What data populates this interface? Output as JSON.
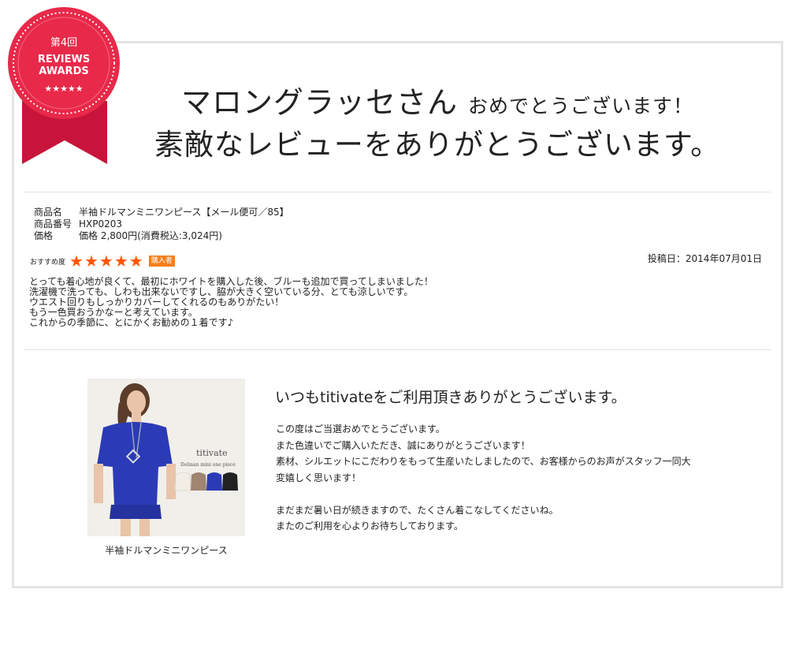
{
  "badge": {
    "edition": "第4回",
    "line1": "REVIEWS",
    "line2": "AWARDS",
    "stars": "★★★★★"
  },
  "headline": {
    "name": "マロングラッセさん",
    "congrats": "おめでとうございます！",
    "thanks": "素敵なレビューをありがとうございます。"
  },
  "product": {
    "name_label": "商品名",
    "name_value": "半袖ドルマンミニワンピース【メール便可／85】",
    "code_label": "商品番号",
    "code_value": "HXP0203",
    "price_label": "価格",
    "price_value": "価格 2,800円(消費税込:3,024円)"
  },
  "rating": {
    "label": "おすすめ度",
    "score": 5,
    "max": 5,
    "buyer_badge": "購入者"
  },
  "posted_date": "投稿日：2014年07月01日",
  "review_text": "とっても着心地が良くて、最初にホワイトを購入した後、ブルーも追加で買ってしまいました！\n洗濯機で洗っても、しわも出来ないですし、脇が大きく空いている分、とても涼しいです。\nウエスト回りもしっかりカバーしてくれるのもありがたい！\nもう一色買おうかなーと考えています。\nこれからの季節に、とにかくお勧めの１着です♪",
  "image": {
    "brand": "titivate",
    "subtitle": "Dolman mini one piece",
    "caption": "半袖ドルマンミニワンピース"
  },
  "shop": {
    "title": "いつもtitivateをご利用頂きありがとうございます。",
    "message": "この度はご当選おめでとうございます。\nまた色違いでご購入いただき、誠にありがとうございます！\n素材、シルエットにこだわりをもって生産いたしましたので、お客様からのお声がスタッフ一同大\n変嬉しく思います！\n\nまだまだ暑い日が続きますので、たくさん着こなしてくださいね。\nまたのご利用を心よりお待ちしております。"
  },
  "colors": {
    "badge_red": "#e8294a",
    "star": "#ff5500",
    "buyer_badge": "#f77d1b",
    "dress_blue": "#2b3bb6"
  }
}
